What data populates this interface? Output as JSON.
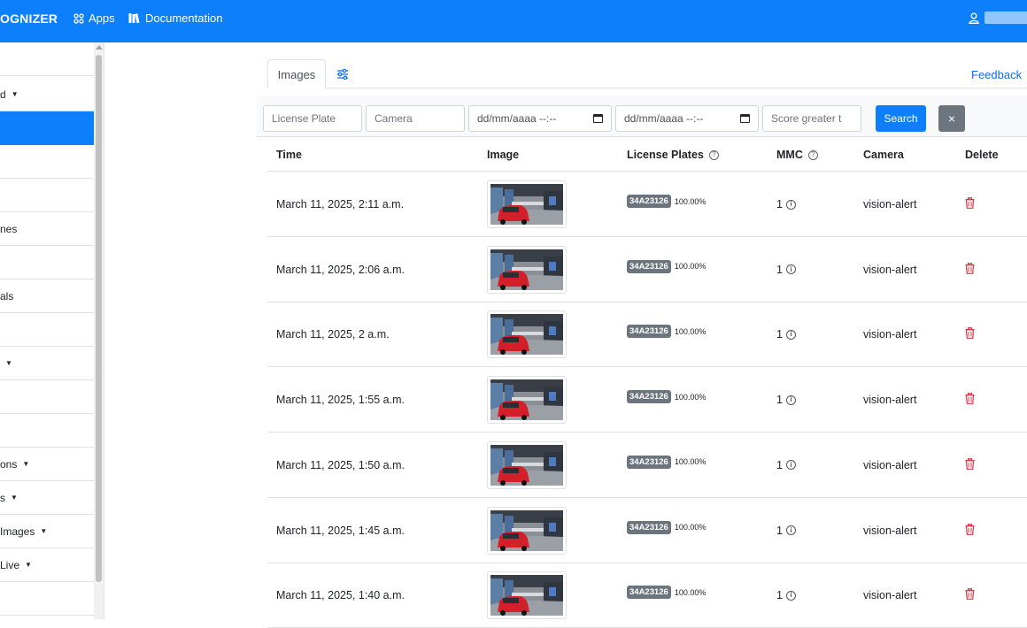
{
  "nav": {
    "brand": "OGNIZER",
    "apps_label": "Apps",
    "docs_label": "Documentation",
    "brand_color": "#0d7ffb"
  },
  "sidebar": {
    "items": [
      {
        "label": "",
        "has_caret": false
      },
      {
        "label": "d",
        "has_caret": true
      },
      {
        "label": "",
        "has_caret": false,
        "active": true
      },
      {
        "label": "",
        "has_caret": false
      },
      {
        "label": "",
        "has_caret": false
      },
      {
        "label": "nes",
        "has_caret": false
      },
      {
        "label": "",
        "has_caret": false
      },
      {
        "label": "als",
        "has_caret": false
      },
      {
        "label": "",
        "has_caret": false
      },
      {
        "label": "",
        "has_caret": true
      },
      {
        "label": "",
        "has_caret": false
      },
      {
        "label": "",
        "has_caret": false
      },
      {
        "label": "ons",
        "has_caret": true
      },
      {
        "label": "s",
        "has_caret": true
      },
      {
        "label": "Images",
        "has_caret": true
      },
      {
        "label": "Live",
        "has_caret": true
      },
      {
        "label": "",
        "has_caret": false
      }
    ]
  },
  "tabs": {
    "images_label": "Images",
    "settings_icon": "sliders-icon",
    "feedback_label": "Feedback"
  },
  "filters": {
    "license_plate_placeholder": "License Plate",
    "camera_placeholder": "Camera",
    "date_from_placeholder": "dd/mm/aaaa --:--",
    "date_to_placeholder": "dd/mm/aaaa --:--",
    "score_placeholder": "Score greater t",
    "search_label": "Search",
    "clear_label": "×"
  },
  "table": {
    "headers": {
      "time": "Time",
      "image": "Image",
      "plates": "License Plates",
      "mmc": "MMC",
      "camera": "Camera",
      "delete": "Delete"
    },
    "rows": [
      {
        "time": "March 11, 2025, 2:11 a.m.",
        "plate": "34A23126",
        "score": "100.00%",
        "mmc": "1",
        "camera": "vision-alert"
      },
      {
        "time": "March 11, 2025, 2:06 a.m.",
        "plate": "34A23126",
        "score": "100.00%",
        "mmc": "1",
        "camera": "vision-alert"
      },
      {
        "time": "March 11, 2025, 2 a.m.",
        "plate": "34A23126",
        "score": "100.00%",
        "mmc": "1",
        "camera": "vision-alert"
      },
      {
        "time": "March 11, 2025, 1:55 a.m.",
        "plate": "34A23126",
        "score": "100.00%",
        "mmc": "1",
        "camera": "vision-alert"
      },
      {
        "time": "March 11, 2025, 1:50 a.m.",
        "plate": "34A23126",
        "score": "100.00%",
        "mmc": "1",
        "camera": "vision-alert"
      },
      {
        "time": "March 11, 2025, 1:45 a.m.",
        "plate": "34A23126",
        "score": "100.00%",
        "mmc": "1",
        "camera": "vision-alert"
      },
      {
        "time": "March 11, 2025, 1:40 a.m.",
        "plate": "34A23126",
        "score": "100.00%",
        "mmc": "1",
        "camera": "vision-alert"
      }
    ]
  }
}
